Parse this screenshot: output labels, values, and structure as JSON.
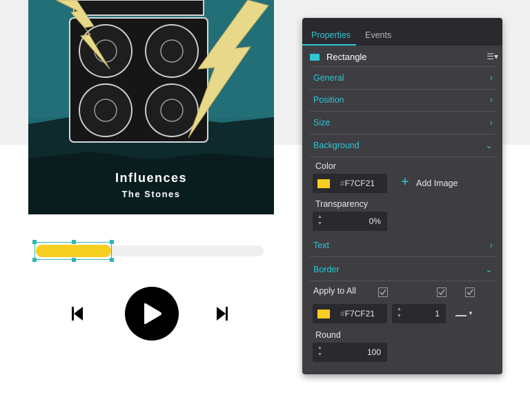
{
  "album": {
    "title": "Influences",
    "artist": "The Stones"
  },
  "player": {
    "progress": 0.33,
    "buttons": {
      "prev": "previous-track",
      "play": "play",
      "next": "next-track"
    }
  },
  "panel": {
    "tabs": [
      {
        "label": "Properties",
        "active": true
      },
      {
        "label": "Events",
        "active": false
      }
    ],
    "object": {
      "name": "Rectangle",
      "swatch_color": "#2fc6d2"
    },
    "sections": {
      "general": "General",
      "position": "Position",
      "size": "Size",
      "background": "Background",
      "text": "Text",
      "border": "Border"
    },
    "background": {
      "color_label": "Color",
      "color_hash": "#",
      "color_value": "F7CF21",
      "add_image_label": "Add Image",
      "transparency_label": "Transparency",
      "transparency_value": "0%"
    },
    "border": {
      "apply_all_label": "Apply to All",
      "color_hash": "#",
      "color_value": "F7CF21",
      "width_value": "1",
      "round_label": "Round",
      "round_value": "100"
    }
  },
  "colors": {
    "accent": "#2fc6d2",
    "fill": "#F7CF21",
    "panel_bg": "#3d3d42"
  }
}
